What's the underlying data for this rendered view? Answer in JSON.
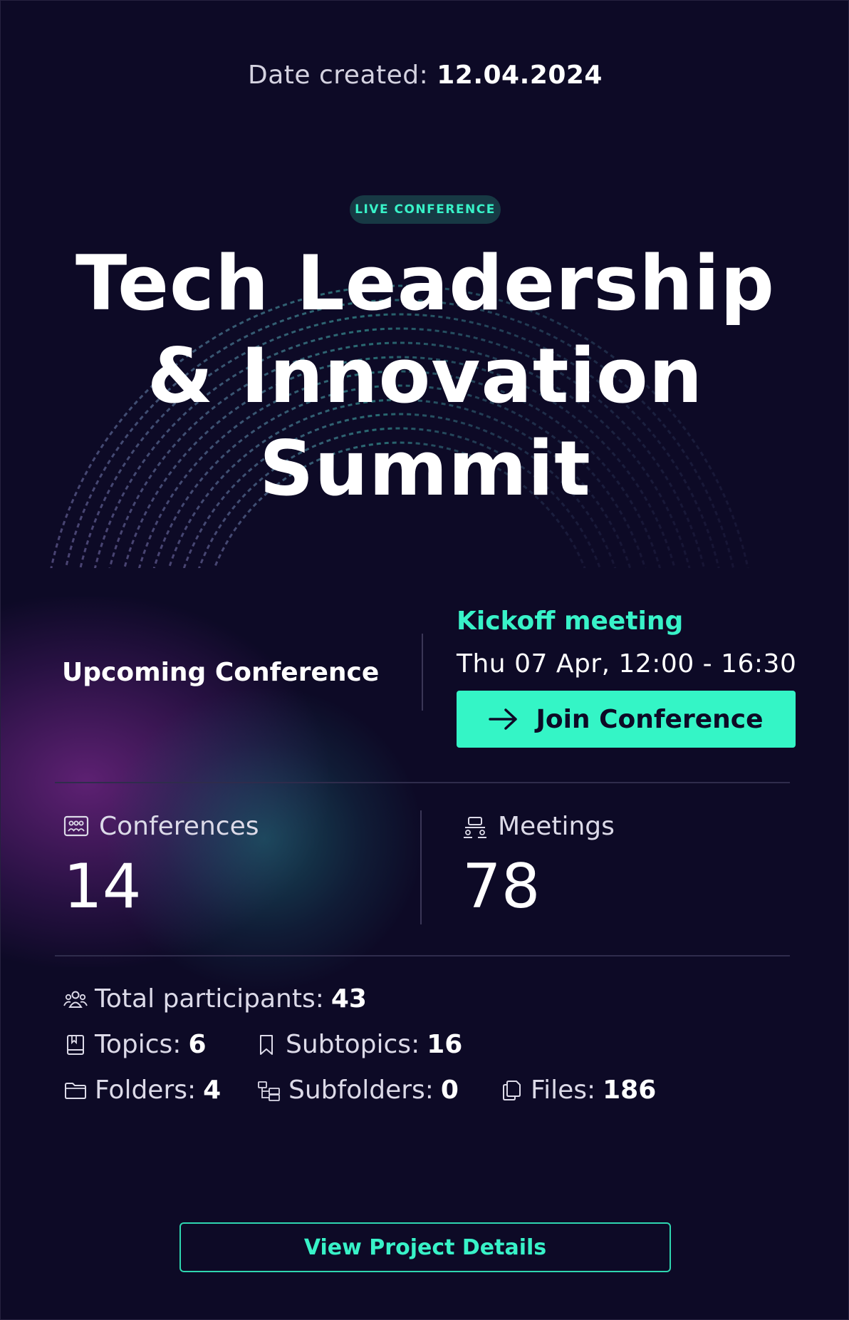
{
  "header": {
    "date_label": "Date created:",
    "date_value": "12.04.2024"
  },
  "badge": {
    "label": "LIVE CONFERENCE"
  },
  "title": {
    "lines": [
      "Tech Leadership",
      "& Innovation",
      "Summit"
    ]
  },
  "upcoming": {
    "label": "Upcoming Conference",
    "meeting_title": "Kickoff meeting",
    "meeting_time": "Thu 07 Apr, 12:00 - 16:30",
    "join_label": "Join Conference"
  },
  "stats": {
    "conferences": {
      "label": "Conferences",
      "value": "14",
      "icon": "conference-icon"
    },
    "meetings": {
      "label": "Meetings",
      "value": "78",
      "icon": "meeting-icon"
    }
  },
  "meta": {
    "participants": {
      "label": "Total participants:",
      "value": "43",
      "icon": "participants-icon"
    },
    "topics": {
      "label": "Topics:",
      "value": "6",
      "icon": "book-icon"
    },
    "subtopics": {
      "label": "Subtopics:",
      "value": "16",
      "icon": "bookmark-icon"
    },
    "folders": {
      "label": "Folders:",
      "value": "4",
      "icon": "folder-icon"
    },
    "subfolders": {
      "label": "Subfolders:",
      "value": "0",
      "icon": "subfolder-icon"
    },
    "files": {
      "label": "Files:",
      "value": "186",
      "icon": "files-icon"
    }
  },
  "footer": {
    "details_label": "View Project Details"
  },
  "colors": {
    "background": "#0d0a26",
    "accent": "#34f5c6",
    "accent_text": "#38f2c8",
    "badge_bg": "#173944"
  }
}
